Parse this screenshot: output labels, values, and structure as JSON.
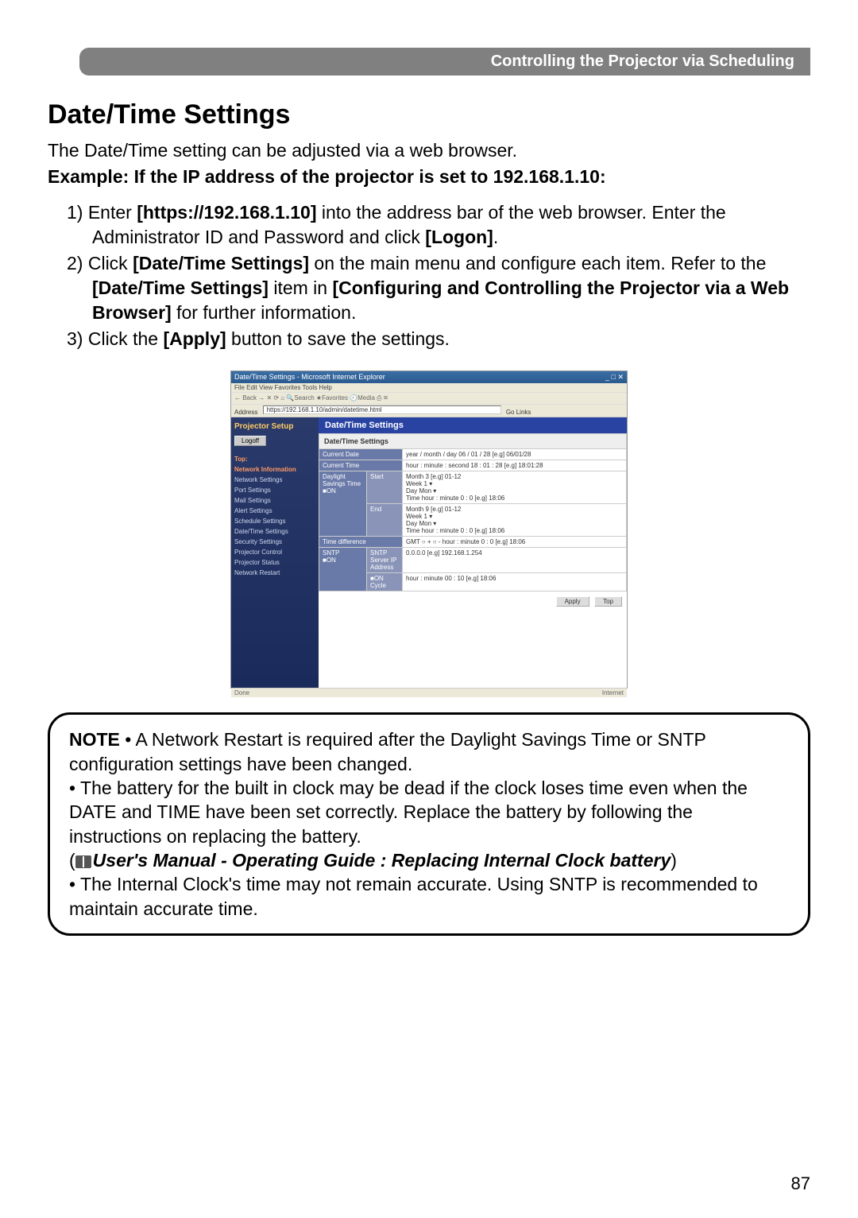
{
  "header": {
    "section": "Controlling the Projector via Scheduling"
  },
  "title": "Date/Time Settings",
  "intro": "The Date/Time setting can be adjusted via a web browser.",
  "example_line": "Example: If the IP address of the projector is set to 192.168.1.10:",
  "steps": {
    "s1_num": "1) ",
    "s1_a": "Enter ",
    "s1_url": "[https://192.168.1.10]",
    "s1_b": " into the address bar of the web browser. Enter the Administrator ID and Password and click ",
    "s1_logon": "[Logon]",
    "s1_c": ".",
    "s2_num": "2) ",
    "s2_a": "Click ",
    "s2_dt": "[Date/Time Settings]",
    "s2_b": " on the main menu and configure each item. Refer to the ",
    "s2_dt2": "[Date/Time Settings]",
    "s2_c": " item in ",
    "s2_conf": "[Configuring and Controlling the Projector via a Web Browser]",
    "s2_d": " for further information.",
    "s3_num": "3) ",
    "s3_a": "Click the ",
    "s3_apply": "[Apply]",
    "s3_b": " button to save the settings."
  },
  "screenshot": {
    "window_title": "Date/Time Settings - Microsoft Internet Explorer",
    "menubar": "File  Edit  View  Favorites  Tools  Help",
    "toolbar": "← Back  →  ✕  ⟳  ⌂  🔍Search  ★Favorites  🕘Media  ⎙  ✉",
    "address_label": "Address",
    "address": "https://192.168.1.10/admin/datetime.html",
    "go": "Go  Links",
    "setup_title": "Projector Setup",
    "logoff": "Logoff",
    "nav_top": "Top:",
    "nav_netinfo": "Network Information",
    "nav_items": [
      "Network Settings",
      "Port Settings",
      "Mail Settings",
      "Alert Settings",
      "Schedule Settings",
      "Date/Time Settings",
      "Security Settings",
      "Projector Control",
      "Projector Status",
      "Network Restart"
    ],
    "main_title": "Date/Time Settings",
    "table_header": "Date/Time Settings",
    "row_date_label": "Current Date",
    "row_date_val": "year / month / day  06  / 01  / 28   [e.g] 06/01/28",
    "row_time_label": "Current Time",
    "row_time_val": "hour : minute : second  18  : 01  : 28   [e.g] 18:01:28",
    "dst_label": "Daylight Savings Time",
    "on1": "■ON",
    "start_label": "Start",
    "start_val": "Month 3   [e.g] 01-12\nWeek 1 ▾\nDay Mon ▾\nTime hour : minute  0 : 0   [e.g] 18:06",
    "end_label": "End",
    "end_val": "Month 9   [e.g] 01-12\nWeek 1 ▾\nDay Mon ▾\nTime hour : minute  0 : 0   [e.g] 18:06",
    "tdiff_label": "Time difference",
    "tdiff_val": "GMT  ○ +  ○ -   hour : minute  0 : 0   [e.g] 18:06",
    "sntp_label": "SNTP",
    "on2": "■ON",
    "sntp_serv_label": "SNTP Server IP Address",
    "sntp_serv_val": "0.0.0.0        [e.g] 192.168.1.254",
    "on3": "■ON",
    "cycle_label": "Cycle",
    "cycle_val": "hour : minute  00 : 10   [e.g] 18:06",
    "apply_btn": "Apply",
    "top_btn": "Top",
    "status_left": "Done",
    "status_right": "Internet"
  },
  "note": {
    "label": "NOTE",
    "n1": "  • A Network Restart is required after the Daylight Savings Time or SNTP configuration settings have been changed.",
    "n2": "• The battery for the built in clock may be dead if the clock loses time even when the DATE and TIME have been set correctly. Replace the battery by following the instructions on replacing the battery.",
    "manual_open": "(",
    "manual_ref": "User's Manual - Operating Guide : Replacing Internal Clock battery",
    "manual_close": ")",
    "n3": "• The Internal Clock's time may not remain accurate. Using SNTP is recommended to maintain accurate time."
  },
  "page_number": "87"
}
